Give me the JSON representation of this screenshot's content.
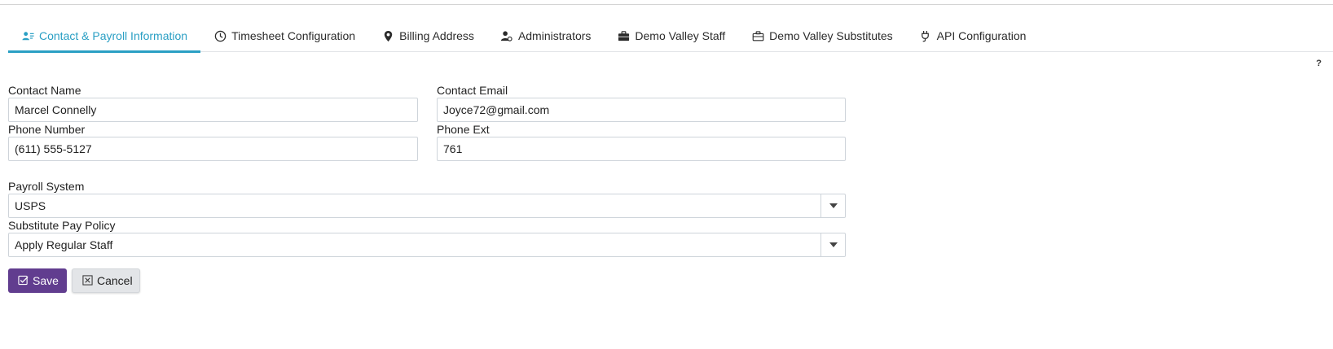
{
  "tabs": [
    {
      "label": "Contact & Payroll Information",
      "icon": "contact-card-icon",
      "active": true
    },
    {
      "label": "Timesheet Configuration",
      "icon": "clock-icon",
      "active": false
    },
    {
      "label": "Billing Address",
      "icon": "map-marker-icon",
      "active": false
    },
    {
      "label": "Administrators",
      "icon": "user-admin-icon",
      "active": false
    },
    {
      "label": "Demo Valley Staff",
      "icon": "briefcase-icon",
      "active": false
    },
    {
      "label": "Demo Valley Substitutes",
      "icon": "briefcase-outline-icon",
      "active": false
    },
    {
      "label": "API Configuration",
      "icon": "plug-icon",
      "active": false
    }
  ],
  "help_label": "?",
  "form": {
    "contact_name": {
      "label": "Contact Name",
      "value": "Marcel Connelly"
    },
    "contact_email": {
      "label": "Contact Email",
      "value": "Joyce72@gmail.com"
    },
    "phone_number": {
      "label": "Phone Number",
      "value": "(611) 555-5127"
    },
    "phone_ext": {
      "label": "Phone Ext",
      "value": "761"
    },
    "payroll_system": {
      "label": "Payroll System",
      "value": "USPS"
    },
    "substitute_pay_policy": {
      "label": "Substitute Pay Policy",
      "value": "Apply Regular Staff"
    }
  },
  "buttons": {
    "save_label": "Save",
    "cancel_label": "Cancel"
  },
  "colors": {
    "accent": "#2a9fc4",
    "save_bg": "#613d8f",
    "cancel_bg": "#e3e5e8"
  }
}
